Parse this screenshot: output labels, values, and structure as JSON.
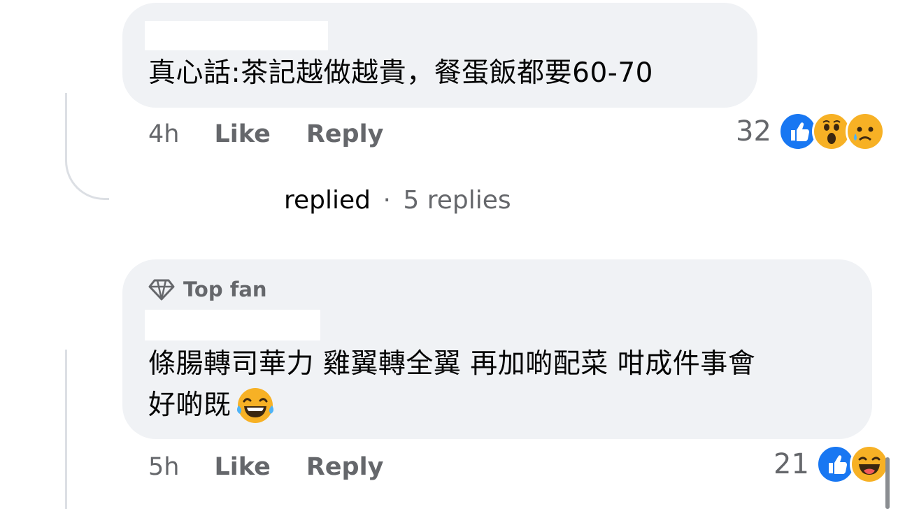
{
  "comments": [
    {
      "text": "真心話:茶記越做越貴，餐蛋飯都要60-70",
      "time": "4h",
      "like_label": "Like",
      "reply_label": "Reply",
      "reaction_count": "32",
      "reactions": [
        "like-icon",
        "wow-icon",
        "sad-icon"
      ]
    },
    {
      "badge": "Top fan",
      "text_line1": "條腸轉司華力 雞翼轉全翼 再加啲配菜 咁成件事會",
      "text_line2": "好啲既",
      "emoji": "😂",
      "time": "5h",
      "like_label": "Like",
      "reply_label": "Reply",
      "reaction_count": "21",
      "reactions": [
        "like-icon",
        "haha-icon"
      ]
    }
  ],
  "replies_summary": {
    "replied": "replied",
    "separator": "·",
    "count": "5 replies"
  },
  "colors": {
    "bubble": "#f0f2f5",
    "meta_text": "#65676b",
    "like_blue": "#1877f2",
    "emoji_yellow": "#f7b125"
  }
}
